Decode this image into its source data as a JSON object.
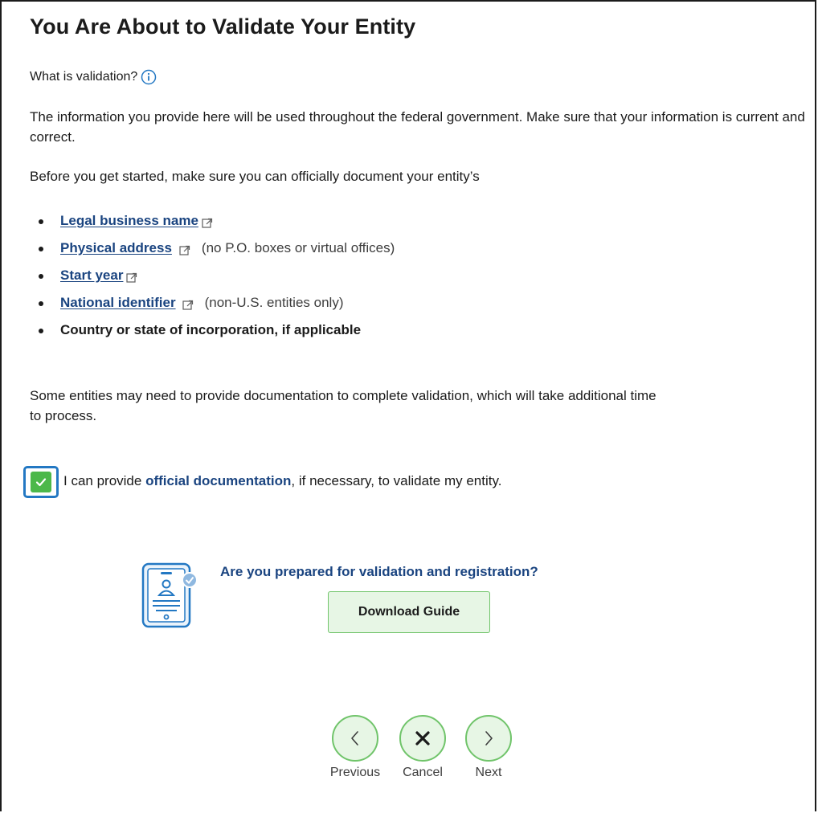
{
  "page": {
    "title": "You Are About to Validate Your Entity",
    "what_is": "What is validation?",
    "intro": "The information you provide here will be used throughout the federal government. Make sure that your information is current and correct.",
    "before": "Before you get started, make sure you can officially document your entity’s"
  },
  "requirements": [
    {
      "label": "Legal business name",
      "note": ""
    },
    {
      "label": "Physical address",
      "note": "(no P.O. boxes or virtual offices)"
    },
    {
      "label": "Start year",
      "note": ""
    },
    {
      "label": "National identifier",
      "note": "(non-U.S. entities only)"
    },
    {
      "label": "Country or state of incorporation, if applicable",
      "note": ""
    }
  ],
  "documentation_note": "Some entities may need to provide documentation to complete validation, which will take additional time to process.",
  "checkbox": {
    "checked": true,
    "label_pre": "I can provide ",
    "label_bold": "official documentation",
    "label_post": ", if necessary, to validate my entity."
  },
  "prepared": {
    "question": "Are you prepared for validation and registration?",
    "button": "Download Guide"
  },
  "navigation": {
    "previous": "Previous",
    "cancel": "Cancel",
    "next": "Next"
  },
  "colors": {
    "link": "#1a4480",
    "accent_green": "#4cb84a",
    "button_bg": "#e7f6e5",
    "focus_blue": "#2378c3"
  }
}
